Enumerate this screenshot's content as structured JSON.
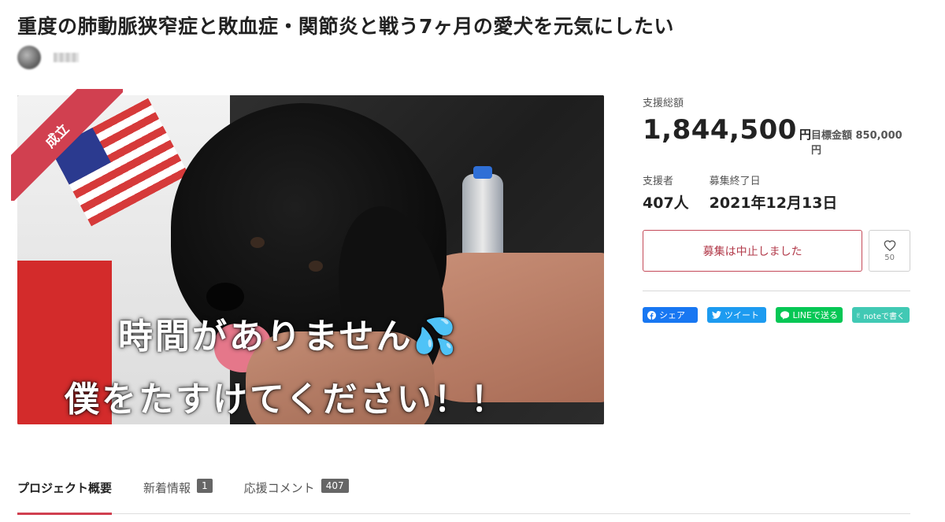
{
  "project": {
    "title": "重度の肺動脈狭窄症と敗血症・関節炎と戦う7ヶ月の愛犬を元気にしたい"
  },
  "hero": {
    "ribbon": "成立",
    "overlay_line1": "時間がありません💦",
    "overlay_line2": "僕をたすけてください！！"
  },
  "funding": {
    "total_label": "支援総額",
    "total_amount": "1,844,500",
    "currency": "円",
    "goal_label": "目標金額 850,000円",
    "supporters_label": "支援者",
    "supporters_value": "407人",
    "end_label": "募集終了日",
    "end_value": "2021年12月13日"
  },
  "actions": {
    "stop_button": "募集は中止しました",
    "favorite_count": "50"
  },
  "share": {
    "facebook": "シェア",
    "twitter": "ツイート",
    "line": "LINEで送る",
    "note": "noteで書く"
  },
  "tabs": [
    {
      "label": "プロジェクト概要"
    },
    {
      "label": "新着情報",
      "badge": "1"
    },
    {
      "label": "応援コメント",
      "badge": "407"
    }
  ],
  "colors": {
    "accent": "#d14050",
    "stop_border": "#c44a59",
    "facebook": "#1877f2",
    "twitter": "#1d9bf0",
    "line": "#06c755",
    "note": "#41c9b4"
  }
}
